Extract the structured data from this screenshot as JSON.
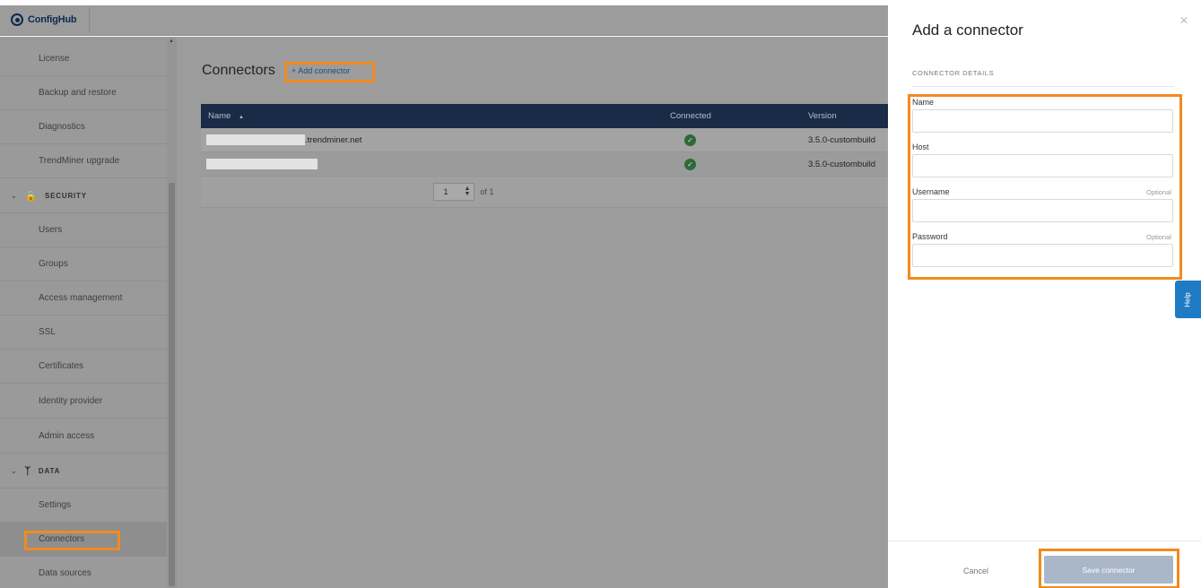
{
  "app": {
    "name": "ConfigHub"
  },
  "sidebar": {
    "items": [
      {
        "label": "License"
      },
      {
        "label": "Backup and restore"
      },
      {
        "label": "Diagnostics"
      },
      {
        "label": "TrendMiner upgrade"
      }
    ],
    "security": {
      "label": "SECURITY",
      "items": [
        {
          "label": "Users"
        },
        {
          "label": "Groups"
        },
        {
          "label": "Access management"
        },
        {
          "label": "SSL"
        },
        {
          "label": "Certificates"
        },
        {
          "label": "Identity provider"
        },
        {
          "label": "Admin access"
        }
      ]
    },
    "data": {
      "label": "DATA",
      "items": [
        {
          "label": "Settings"
        },
        {
          "label": "Connectors"
        },
        {
          "label": "Data sources"
        }
      ]
    }
  },
  "main": {
    "title": "Connectors",
    "add_label": "+ Add connector",
    "table": {
      "columns": [
        "Name",
        "Connected",
        "Version"
      ],
      "sort_indicator": "▲",
      "rows": [
        {
          "name": ".trendminer.net",
          "version": "3.5.0-custombuild"
        },
        {
          "name": "",
          "version": "3.5.0-custombuild"
        }
      ],
      "pager": {
        "page": "1",
        "of": "of 1"
      }
    }
  },
  "drawer": {
    "title": "Add a connector",
    "section": "CONNECTOR DETAILS",
    "fields": {
      "name": {
        "label": "Name",
        "value": ""
      },
      "host": {
        "label": "Host",
        "value": ""
      },
      "username": {
        "label": "Username",
        "optional": "Optional",
        "value": ""
      },
      "password": {
        "label": "Password",
        "optional": "Optional",
        "value": ""
      }
    },
    "cancel": "Cancel",
    "save": "Save connector",
    "help": "Help"
  },
  "colors": {
    "highlight": "#f28a1e",
    "table_header": "#1a2b48",
    "help_tab": "#1e7bc4",
    "save_button": "#a9b7c8",
    "connected_check": "#2c6a3a"
  }
}
